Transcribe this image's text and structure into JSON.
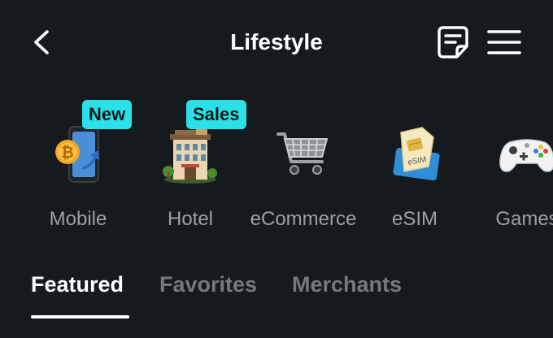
{
  "header": {
    "title": "Lifestyle",
    "back_icon": "chevron-left-icon",
    "doc_icon": "document-icon",
    "menu_icon": "hamburger-menu-icon"
  },
  "categories": [
    {
      "label": "Mobile",
      "icon": "mobile-topup-icon",
      "badge": "New"
    },
    {
      "label": "Hotel",
      "icon": "hotel-icon",
      "badge": "Sales"
    },
    {
      "label": "eCommerce",
      "icon": "shopping-cart-icon"
    },
    {
      "label": "eSIM",
      "icon": "esim-card-icon"
    },
    {
      "label": "Games",
      "icon": "game-controller-icon"
    }
  ],
  "tabs": [
    {
      "label": "Featured",
      "active": true
    },
    {
      "label": "Favorites",
      "active": false
    },
    {
      "label": "Merchants",
      "active": false
    }
  ],
  "colors": {
    "background": "#141A1D",
    "badge": "#2CE0E8",
    "inactive_text": "#73797C",
    "label_text": "#9AA1A4"
  }
}
